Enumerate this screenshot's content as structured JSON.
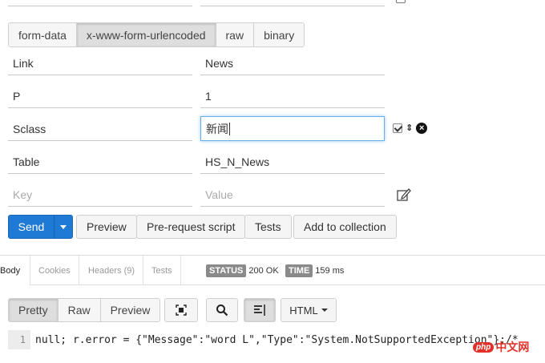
{
  "body_types": [
    {
      "label": "form-data",
      "active": false
    },
    {
      "label": "x-www-form-urlencoded",
      "active": true
    },
    {
      "label": "raw",
      "active": false
    },
    {
      "label": "binary",
      "active": false
    }
  ],
  "params": [
    {
      "key": "Link",
      "value": "News"
    },
    {
      "key": "P",
      "value": "1"
    },
    {
      "key": "Sclass",
      "value": "新闻"
    },
    {
      "key": "Table",
      "value": "HS_N_News"
    }
  ],
  "new_param": {
    "key_placeholder": "Key",
    "value_placeholder": "Value"
  },
  "actions": {
    "send": "Send",
    "preview": "Preview",
    "prerequest": "Pre-request script",
    "tests": "Tests",
    "add_collection": "Add to collection"
  },
  "response_tabs": [
    "Body",
    "Cookies",
    "Headers (9)",
    "Tests"
  ],
  "status": {
    "status_label": "STATUS",
    "status_value": "200 OK",
    "time_label": "TIME",
    "time_value": "159 ms"
  },
  "view_modes": [
    {
      "label": "Pretty",
      "active": true
    },
    {
      "label": "Raw",
      "active": false
    },
    {
      "label": "Preview",
      "active": false
    }
  ],
  "format": "HTML",
  "code": {
    "line": "1",
    "text": "null; r.error = {\"Message\":\"word L\",\"Type\":\"System.NotSupportedException\"};/*"
  },
  "watermark": {
    "php": "php",
    "cn": "中文网"
  },
  "colors": {
    "primary": "#1f7ad6",
    "focus": "#66afe9",
    "badge": "#8a8a8a"
  }
}
